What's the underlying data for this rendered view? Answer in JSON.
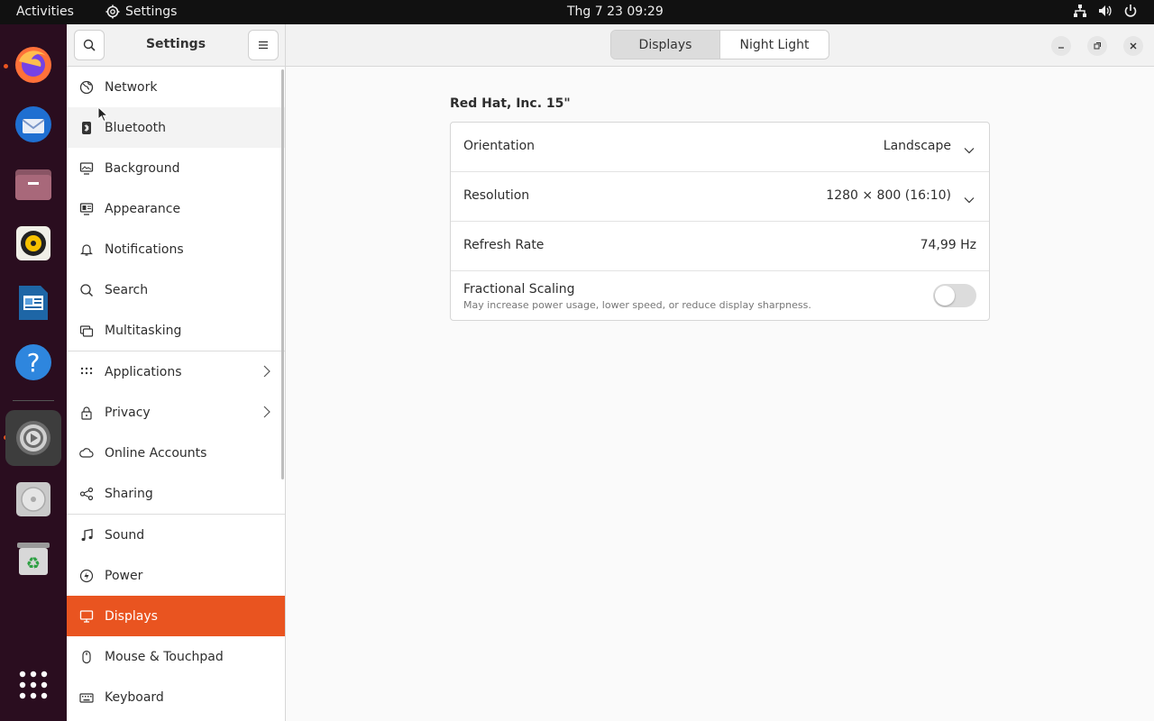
{
  "topbar": {
    "activities": "Activities",
    "app_name": "Settings",
    "clock": "Thg 7 23  09:29"
  },
  "dock": {
    "items": [
      {
        "name": "firefox",
        "icon": "firefox-icon",
        "running": true
      },
      {
        "name": "thunderbird",
        "icon": "thunderbird-icon",
        "running": false
      },
      {
        "name": "files",
        "icon": "files-icon",
        "running": false
      },
      {
        "name": "rhythmbox",
        "icon": "rhythmbox-icon",
        "running": false
      },
      {
        "name": "writer",
        "icon": "libreoffice-writer-icon",
        "running": false
      },
      {
        "name": "help",
        "icon": "help-icon",
        "running": false
      },
      {
        "name": "settings",
        "icon": "settings-gear-icon",
        "running": true,
        "active": true
      },
      {
        "name": "disc",
        "icon": "optical-disc-icon",
        "running": false
      },
      {
        "name": "trash",
        "icon": "trash-icon",
        "running": false
      },
      {
        "name": "app-grid",
        "icon": "app-grid-icon",
        "running": false
      }
    ],
    "accent": "#e95420"
  },
  "sidebar": {
    "title": "Settings",
    "items": [
      {
        "label": "Network",
        "icon": "globe-icon"
      },
      {
        "label": "Bluetooth",
        "icon": "bluetooth-icon"
      },
      {
        "label": "Background",
        "icon": "monitor-wallpaper-icon"
      },
      {
        "label": "Appearance",
        "icon": "appearance-icon"
      },
      {
        "label": "Notifications",
        "icon": "bell-icon"
      },
      {
        "label": "Search",
        "icon": "search-icon"
      },
      {
        "label": "Multitasking",
        "icon": "multitasking-icon"
      },
      {
        "label": "Applications",
        "icon": "apps-grid-icon",
        "has_submenu": true
      },
      {
        "label": "Privacy",
        "icon": "lock-icon",
        "has_submenu": true
      },
      {
        "label": "Online Accounts",
        "icon": "cloud-icon"
      },
      {
        "label": "Sharing",
        "icon": "share-icon"
      },
      {
        "label": "Sound",
        "icon": "music-note-icon"
      },
      {
        "label": "Power",
        "icon": "power-icon"
      },
      {
        "label": "Displays",
        "icon": "display-icon",
        "selected": true
      },
      {
        "label": "Mouse & Touchpad",
        "icon": "mouse-icon"
      },
      {
        "label": "Keyboard",
        "icon": "keyboard-icon"
      }
    ]
  },
  "header": {
    "tabs": [
      {
        "label": "Displays",
        "active": true
      },
      {
        "label": "Night Light",
        "active": false
      }
    ]
  },
  "main": {
    "display_name": "Red Hat, Inc. 15\"",
    "rows": {
      "orientation": {
        "label": "Orientation",
        "value": "Landscape"
      },
      "resolution": {
        "label": "Resolution",
        "value": "1280 × 800 (16:10)"
      },
      "refresh_rate": {
        "label": "Refresh Rate",
        "value": "74,99 Hz"
      },
      "fractional_scaling": {
        "label": "Fractional Scaling",
        "description": "May increase power usage, lower speed, or reduce display sharpness.",
        "enabled": false
      }
    }
  },
  "colors": {
    "accent": "#e95420",
    "topbar_bg": "#111111",
    "dock_bg": "#2a0d1f"
  }
}
